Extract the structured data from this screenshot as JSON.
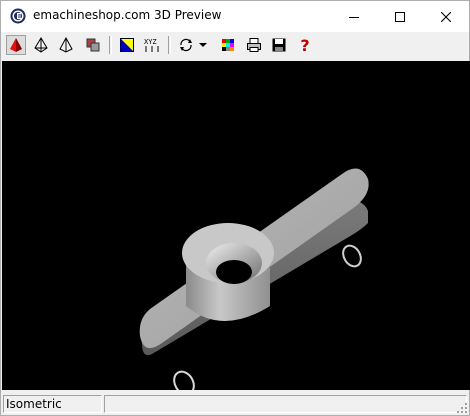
{
  "window": {
    "title": "emachineshop.com 3D Preview",
    "buttons": {
      "minimize": "minimize",
      "maximize": "maximize",
      "close": "close"
    }
  },
  "toolbar": {
    "items": [
      {
        "name": "solid-view-icon",
        "color": "#cc0000"
      },
      {
        "name": "wireframe-view-icon"
      },
      {
        "name": "outline-view-icon"
      },
      {
        "name": "parts-icon"
      },
      {
        "name": "color-fill-icon"
      },
      {
        "name": "xyz-axes-icon"
      },
      {
        "name": "rotate-icon"
      },
      {
        "name": "dropdown-arrow-icon"
      },
      {
        "name": "color-palette-icon"
      },
      {
        "name": "print-icon"
      },
      {
        "name": "save-icon"
      },
      {
        "name": "help-icon",
        "text": "?"
      }
    ],
    "axes_label": "XYZ"
  },
  "viewport": {
    "background": "#000000",
    "model": "flange-bracket"
  },
  "statusbar": {
    "view_mode": "Isometric",
    "second_panel": ""
  }
}
